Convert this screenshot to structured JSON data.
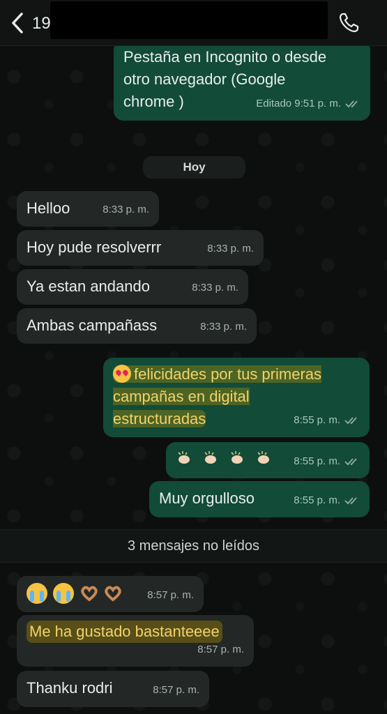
{
  "header": {
    "contact_partial": "19",
    "back_icon": "chevron-left-icon",
    "call_icon": "phone-icon"
  },
  "messages": [
    {
      "id": "m1",
      "dir": "out",
      "text": "Pestaña en Incognito o desde\notro navegador (Google\nchrome )",
      "time": "Editado 9:51 p. m.",
      "highlight": false
    },
    {
      "id": "m2",
      "dir": "in",
      "text": "Helloo",
      "time": "8:33 p. m."
    },
    {
      "id": "m3",
      "dir": "in",
      "text": "Hoy pude resolverrr",
      "time": "8:33 p. m."
    },
    {
      "id": "m4",
      "dir": "in",
      "text": "Ya estan andando",
      "time": "8:33 p. m."
    },
    {
      "id": "m5",
      "dir": "in",
      "text": "Ambas campañass",
      "time": "8:33 p. m."
    },
    {
      "id": "m6",
      "dir": "out",
      "emoji": "😍",
      "text": "felicidades por tus primeras\ncampañas en digital\nestructuradas",
      "time": "8:55 p. m.",
      "highlight": true
    },
    {
      "id": "m7",
      "dir": "out",
      "emoji": "👏🏻👏🏻👏🏻👏🏻",
      "text": "",
      "time": "8:55 p. m."
    },
    {
      "id": "m8",
      "dir": "out",
      "text": "Muy orgulloso",
      "time": "8:55 p. m."
    },
    {
      "id": "m9",
      "dir": "in",
      "emoji": "😭😭🫶🏽🫶🏽",
      "text": "",
      "time": "8:57 p. m."
    },
    {
      "id": "m10",
      "dir": "in",
      "text": "Me ha gustado bastanteeee",
      "time": "8:57 p. m.",
      "highlight": true
    },
    {
      "id": "m11",
      "dir": "in",
      "text": "Thanku rodri",
      "time": "8:57 p. m."
    }
  ],
  "date_separator": "Hoy",
  "unread_label": "3 mensajes no leídos",
  "colors": {
    "incoming_bubble": "#232826",
    "outgoing_bubble": "#124b38",
    "highlight": "#f1d36a"
  }
}
